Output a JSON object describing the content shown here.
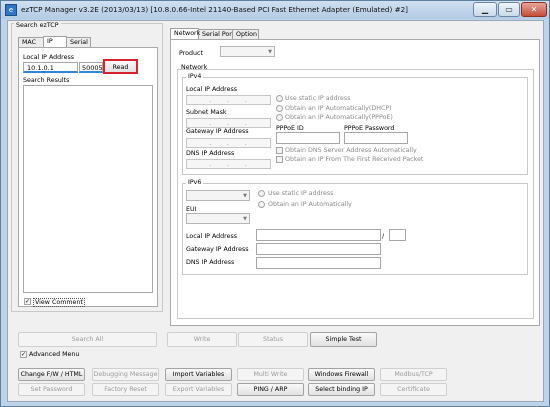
{
  "window": {
    "title": "ezTCP Manager v3.2E (2013/03/13) [10.8.0.66-Intel 21140-Based PCI Fast Ethernet Adapter (Emulated) #2]"
  },
  "search": {
    "group_label": "Search ezTCP",
    "tabs": [
      "MAC",
      "IP",
      "Serial"
    ],
    "local_ip_label": "Local IP Address",
    "local_ip_value": "10.1.0.1",
    "port_value": "50005",
    "read_label": "Read",
    "results_label": "Search Results",
    "view_comment_label": "View Comment"
  },
  "config": {
    "tabs": [
      "Network",
      "Serial Port",
      "Option"
    ],
    "product_label": "Product",
    "network_label": "Network",
    "ipv4": {
      "label": "IPv4",
      "local_ip_label": "Local IP Address",
      "subnet_label": "Subnet Mask",
      "gateway_label": "Gateway IP Address",
      "dns_label": "DNS IP Address",
      "ip_dots": ". . .",
      "radio_static": "Use static IP address",
      "radio_dhcp": "Obtain an IP Automatically(DHCP)",
      "radio_pppoe": "Obtain an IP Automatically(PPPoE)",
      "pppoe_id_label": "PPPoE ID",
      "pppoe_pw_label": "PPPoE Password",
      "chk_dns_auto": "Obtain DNS Server Address Automatically",
      "chk_first_packet": "Obtain an IP From The First Received Packet"
    },
    "ipv6": {
      "label": "IPv6",
      "radio_static": "Use static IP address",
      "radio_auto": "Obtain an IP Automatically",
      "eui_label": "EUI",
      "local_ip_label": "Local IP Address",
      "gateway_label": "Gateway IP Address",
      "dns_label": "DNS IP Address",
      "slash": "/"
    }
  },
  "actions": {
    "search_all": "Search All",
    "write": "Write",
    "status": "Status",
    "simple_test": "Simple Test",
    "advanced_menu": "Advanced Menu"
  },
  "advanced": {
    "row1": [
      "Change F/W / HTML",
      "Debugging Message",
      "Import Variables",
      "Multi Write",
      "Windows Firewall",
      "Modbus/TCP"
    ],
    "row2": [
      "Set Password",
      "Factory Reset",
      "Export Variables",
      "PING / ARP",
      "Select binding IP",
      "Certificate"
    ]
  },
  "colors": {
    "highlight_red": "#d9232d",
    "title_bar": "#bcd3ea",
    "input_underline": "#2f86d6"
  },
  "icons": [
    "app-icon",
    "minimize-icon",
    "maximize-icon",
    "close-icon",
    "dropdown-arrow-icon",
    "checkmark-icon"
  ]
}
